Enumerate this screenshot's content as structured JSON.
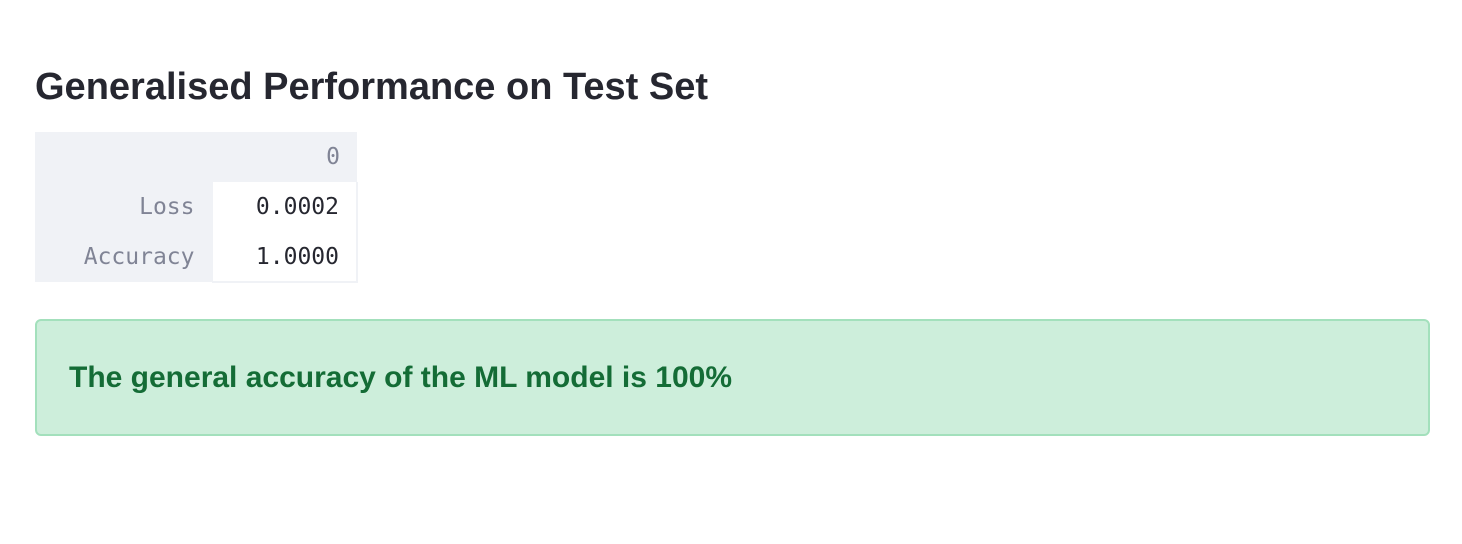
{
  "header": {
    "title": "Generalised Performance on Test Set"
  },
  "table": {
    "column_header": "0",
    "rows": [
      {
        "label": "Loss",
        "value": "0.0002"
      },
      {
        "label": "Accuracy",
        "value": "1.0000"
      }
    ]
  },
  "alert": {
    "type": "success",
    "message": "The general accuracy of the ML model is 100%"
  },
  "colors": {
    "alert_background": "#cdeedb",
    "alert_text": "#146c36",
    "table_header_bg": "#f0f2f6",
    "text": "#262730"
  }
}
